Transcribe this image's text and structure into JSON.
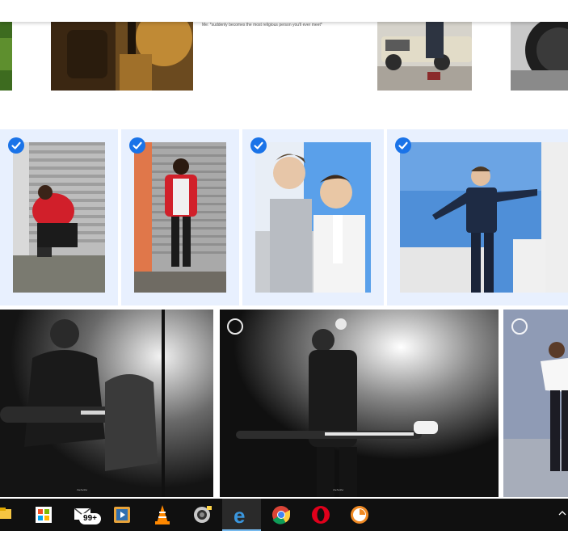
{
  "meme": {
    "caption": "Me: *suddenly becomes the most religious person you'll ever meet*"
  },
  "photos": {
    "selected": [
      {
        "name": "man-red-jacket-crouching",
        "selected": true
      },
      {
        "name": "man-red-jacket-standing",
        "selected": true
      },
      {
        "name": "two-men-white-suits",
        "selected": true
      },
      {
        "name": "man-dark-suit-sky",
        "selected": true
      }
    ],
    "bottom_row": [
      {
        "name": "guitarist-bw-left",
        "selected": false
      },
      {
        "name": "bassist-bw",
        "selected": false
      },
      {
        "name": "woman-white-top",
        "selected": false
      }
    ]
  },
  "taskbar": {
    "icons": [
      "file-explorer-icon",
      "microsoft-store-icon",
      "mail-icon",
      "media-player-icon",
      "vlc-icon",
      "camera-app-icon",
      "edge-icon",
      "chrome-icon",
      "opera-icon",
      "timer-icon"
    ],
    "mail_badge": "99+",
    "colors": {
      "chrome": "#34a853",
      "opera": "#e0001b",
      "edge": "#0a7bd4",
      "vlc": "#ff8800"
    }
  }
}
